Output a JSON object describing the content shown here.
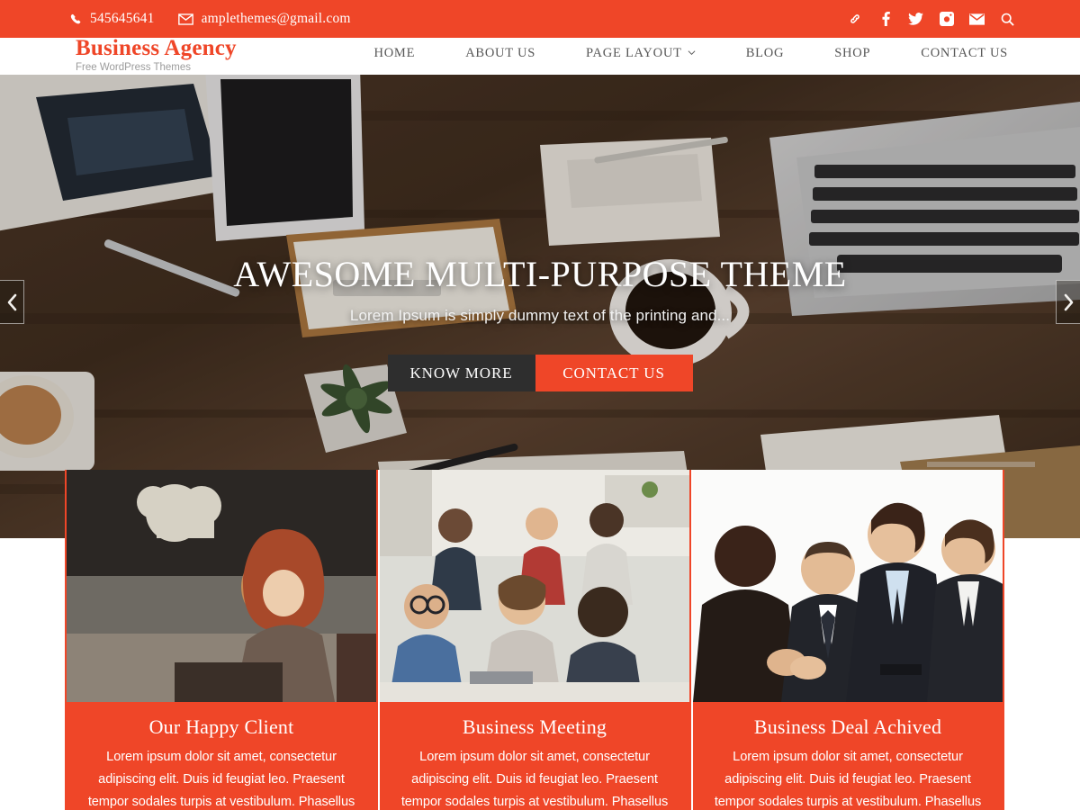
{
  "topbar": {
    "phone": "545645641",
    "email": "amplethemes@gmail.com",
    "phone_icon": "phone-icon",
    "email_icon": "envelope-icon",
    "social": [
      {
        "name": "link-icon",
        "label": "Link"
      },
      {
        "name": "facebook-icon",
        "label": "Facebook"
      },
      {
        "name": "twitter-icon",
        "label": "Twitter"
      },
      {
        "name": "instagram-icon",
        "label": "Instagram"
      },
      {
        "name": "mail-icon",
        "label": "Mail"
      },
      {
        "name": "search-icon",
        "label": "Search"
      }
    ],
    "bg_color": "#ef4628"
  },
  "header": {
    "brand_title": "Business Agency",
    "brand_tagline": "Free WordPress Themes",
    "brand_color": "#ef4628",
    "nav": [
      {
        "label": "HOME",
        "has_dropdown": false
      },
      {
        "label": "ABOUT US",
        "has_dropdown": false
      },
      {
        "label": "PAGE LAYOUT",
        "has_dropdown": true
      },
      {
        "label": "BLOG",
        "has_dropdown": false
      },
      {
        "label": "SHOP",
        "has_dropdown": false
      },
      {
        "label": "CONTACT US",
        "has_dropdown": false
      }
    ]
  },
  "hero": {
    "title": "AWESOME MULTI-PURPOSE THEME",
    "subtitle": "Lorem Ipsum is simply dummy text of the printing and...",
    "primary_button": "KNOW MORE",
    "secondary_button": "CONTACT US",
    "prev_arrow": "‹",
    "next_arrow": "›",
    "accent_color": "#ef4628",
    "dark_button_color": "#2e2e2e"
  },
  "cards": [
    {
      "title": "Our Happy Client",
      "text": "Lorem ipsum dolor sit amet, consectetur adipiscing elit. Duis id feugiat leo. Praesent tempor sodales turpis at vestibulum. Phasellus",
      "image_alt": "woman-with-laptop-in-cafe"
    },
    {
      "title": "Business Meeting",
      "text": "Lorem ipsum dolor sit amet, consectetur adipiscing elit. Duis id feugiat leo. Praesent tempor sodales turpis at vestibulum. Phasellus",
      "image_alt": "team-meeting-in-office"
    },
    {
      "title": "Business Deal Achived",
      "text": "Lorem ipsum dolor sit amet, consectetur adipiscing elit. Duis id feugiat leo. Praesent tempor sodales turpis at vestibulum. Phasellus",
      "image_alt": "business-handshake"
    }
  ]
}
